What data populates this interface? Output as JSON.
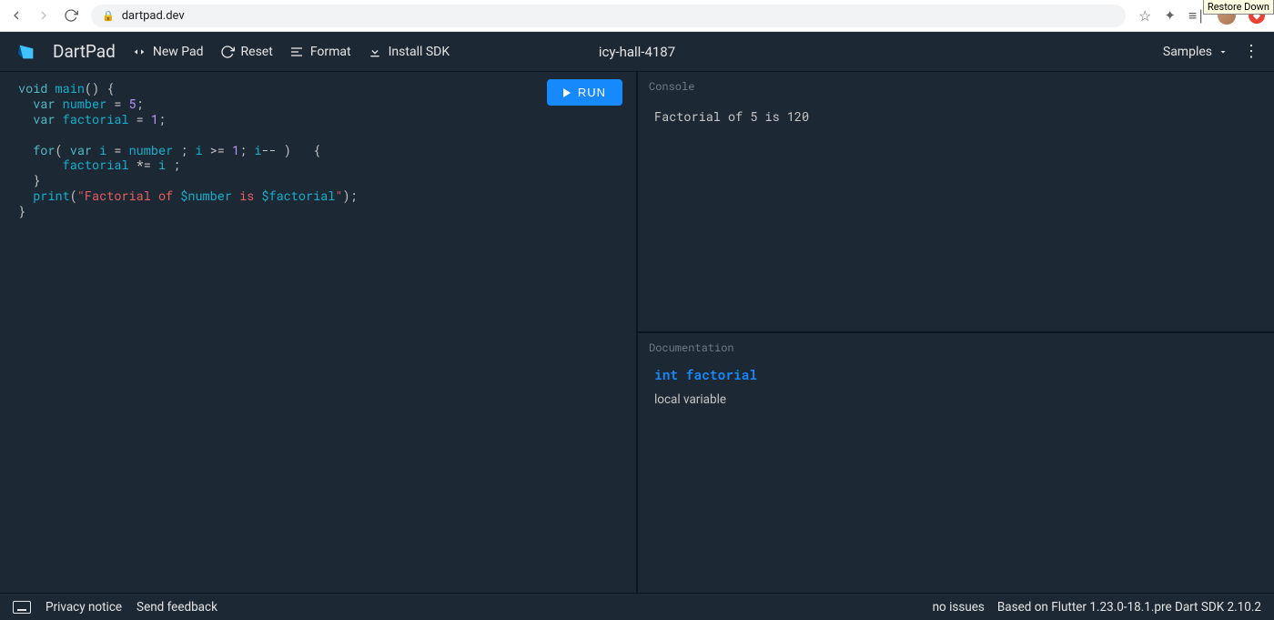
{
  "browser": {
    "url": "dartpad.dev",
    "tooltip": "Restore Down"
  },
  "header": {
    "title": "DartPad",
    "new_pad": "New Pad",
    "reset": "Reset",
    "format": "Format",
    "install_sdk": "Install SDK",
    "pad_name": "icy-hall-4187",
    "samples": "Samples"
  },
  "run_button": "RUN",
  "code_tokens": [
    [
      [
        "kw",
        "void"
      ],
      [
        "op",
        " "
      ],
      [
        "ident",
        "main"
      ],
      [
        "op",
        "() {"
      ]
    ],
    [
      [
        "op",
        "  "
      ],
      [
        "kw",
        "var"
      ],
      [
        "op",
        " "
      ],
      [
        "ident",
        "number"
      ],
      [
        "op",
        " = "
      ],
      [
        "num",
        "5"
      ],
      [
        "op",
        ";"
      ]
    ],
    [
      [
        "op",
        "  "
      ],
      [
        "kw",
        "var"
      ],
      [
        "op",
        " "
      ],
      [
        "ident",
        "factorial"
      ],
      [
        "op",
        " = "
      ],
      [
        "num",
        "1"
      ],
      [
        "op",
        ";"
      ]
    ],
    [],
    [
      [
        "op",
        "  "
      ],
      [
        "kw",
        "for"
      ],
      [
        "op",
        "( "
      ],
      [
        "kw",
        "var"
      ],
      [
        "op",
        " "
      ],
      [
        "ident",
        "i"
      ],
      [
        "op",
        " = "
      ],
      [
        "ident",
        "number"
      ],
      [
        "op",
        " ; "
      ],
      [
        "ident",
        "i"
      ],
      [
        "op",
        " >= "
      ],
      [
        "num",
        "1"
      ],
      [
        "op",
        "; "
      ],
      [
        "ident",
        "i"
      ],
      [
        "op",
        "-- )   {"
      ]
    ],
    [
      [
        "op",
        "      "
      ],
      [
        "ident",
        "factorial"
      ],
      [
        "op",
        " *= "
      ],
      [
        "ident",
        "i"
      ],
      [
        "op",
        " ;"
      ]
    ],
    [
      [
        "op",
        "  }"
      ]
    ],
    [
      [
        "op",
        "  "
      ],
      [
        "ident",
        "print"
      ],
      [
        "op",
        "("
      ],
      [
        "str",
        "\"Factorial of "
      ],
      [
        "interp",
        "$number"
      ],
      [
        "str",
        " is "
      ],
      [
        "interp",
        "$factorial"
      ],
      [
        "str",
        "\""
      ],
      [
        "op",
        ");"
      ]
    ],
    [
      [
        "op",
        "}"
      ]
    ]
  ],
  "console": {
    "label": "Console",
    "output": "Factorial of 5 is 120"
  },
  "docs": {
    "label": "Documentation",
    "signature": "int factorial",
    "description": "local variable"
  },
  "footer": {
    "privacy": "Privacy notice",
    "feedback": "Send feedback",
    "issues": "no issues",
    "sdk": "Based on Flutter 1.23.0-18.1.pre Dart SDK 2.10.2"
  }
}
